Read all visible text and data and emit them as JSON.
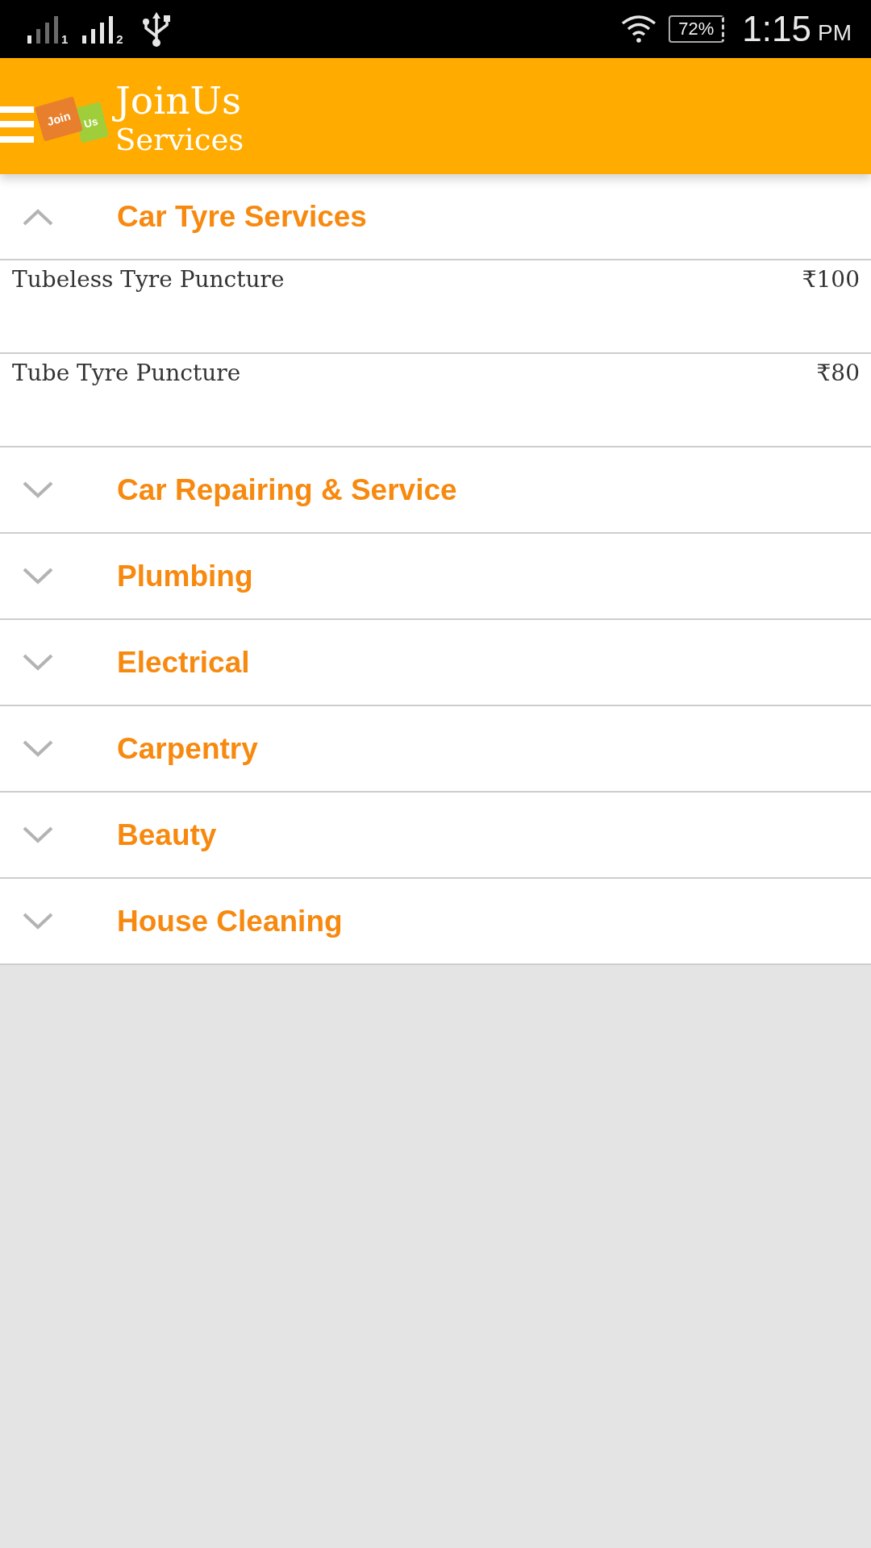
{
  "status_bar": {
    "sim_labels": [
      "1",
      "2"
    ],
    "battery": "72%",
    "time": "1:15",
    "time_period": "PM"
  },
  "app_bar": {
    "logo": {
      "front": "Join",
      "back": "Us"
    },
    "title": "JoinUs",
    "subtitle": "Services"
  },
  "categories": [
    {
      "title": "Car Tyre Services",
      "expanded": true,
      "items": [
        {
          "name": "Tubeless Tyre Puncture",
          "price": "₹100"
        },
        {
          "name": "Tube Tyre Puncture",
          "price": "₹80"
        }
      ]
    },
    {
      "title": "Car Repairing & Service",
      "expanded": false
    },
    {
      "title": "Plumbing",
      "expanded": false
    },
    {
      "title": "Electrical",
      "expanded": false
    },
    {
      "title": "Carpentry",
      "expanded": false
    },
    {
      "title": "Beauty",
      "expanded": false
    },
    {
      "title": "House Cleaning",
      "expanded": false
    }
  ]
}
